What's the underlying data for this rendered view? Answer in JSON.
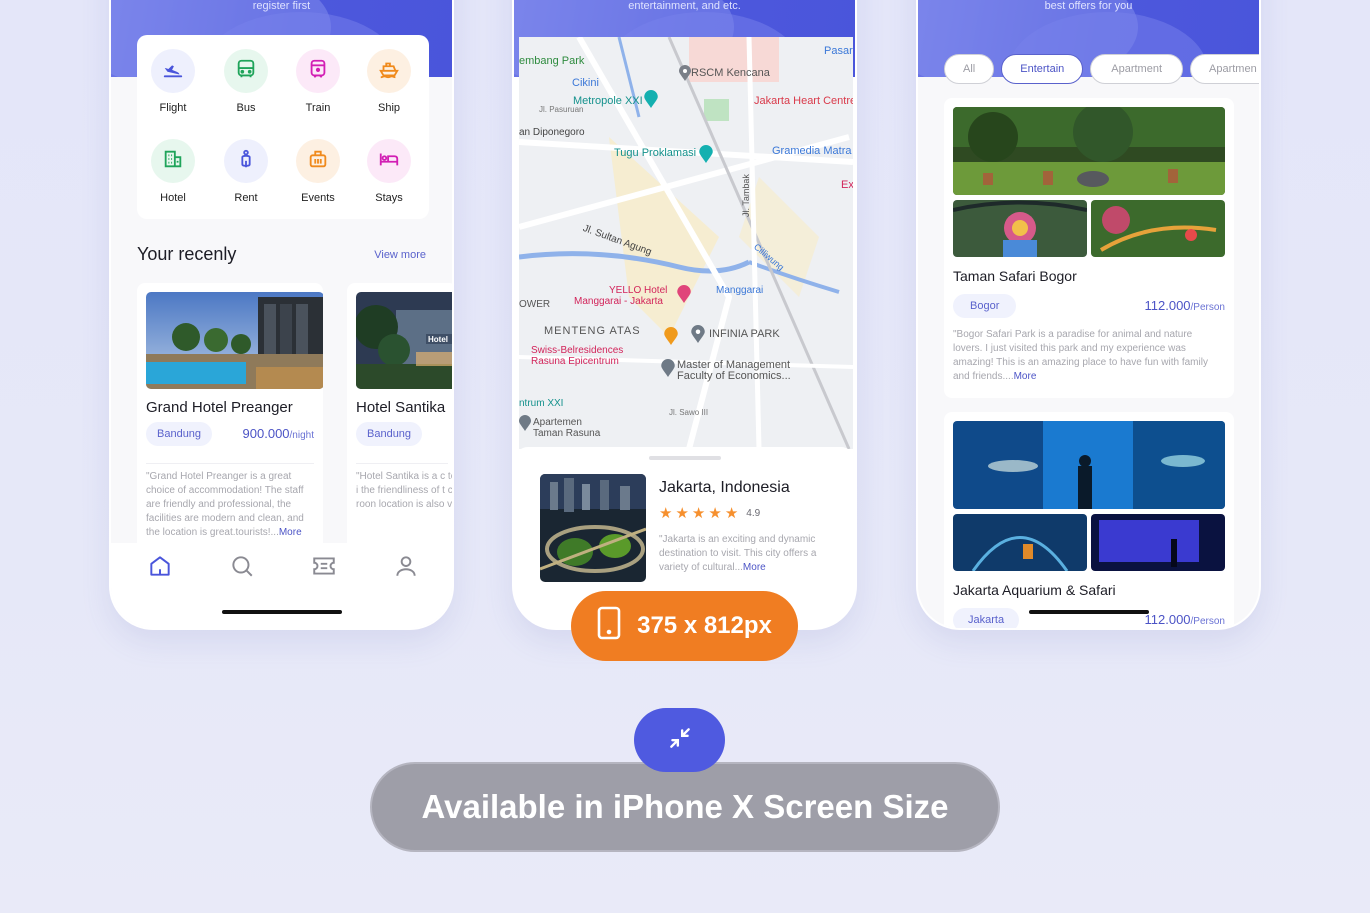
{
  "phone_home": {
    "header_text": "register first",
    "categories": [
      {
        "label": "Flight",
        "icon": "flight-icon",
        "color": "#4a55db",
        "bg": "#eef0fd"
      },
      {
        "label": "Bus",
        "icon": "bus-icon",
        "color": "#1fa45a",
        "bg": "#e7f7ee"
      },
      {
        "label": "Train",
        "icon": "train-icon",
        "color": "#d21fb4",
        "bg": "#fce9f8"
      },
      {
        "label": "Ship",
        "icon": "ship-icon",
        "color": "#f08a1c",
        "bg": "#fdf0e2"
      },
      {
        "label": "Hotel",
        "icon": "hotel-icon",
        "color": "#1fa45a",
        "bg": "#e7f7ee"
      },
      {
        "label": "Rent",
        "icon": "scooter-icon",
        "color": "#4a55db",
        "bg": "#eef0fd"
      },
      {
        "label": "Events",
        "icon": "suitcase-icon",
        "color": "#f08a1c",
        "bg": "#fdf0e2"
      },
      {
        "label": "Stays",
        "icon": "bed-icon",
        "color": "#d21fb4",
        "bg": "#fce9f8"
      }
    ],
    "section_title": "Your recenly",
    "view_more": "View more",
    "hotels": [
      {
        "name": "Grand Hotel Preanger",
        "city": "Bandung",
        "price": "900.000",
        "price_unit": "/night",
        "description": "\"Grand Hotel Preanger is a great choice of accommodation! The staff are friendly and professional, the facilities are modern and clean, and the location is great.tourists!...",
        "more": "More"
      },
      {
        "name": "Hotel Santika",
        "city": "Bandung",
        "description": "\"Hotel Santika is a c to stay! I was very i the friendliness of t comfort of the roon location is also very"
      }
    ],
    "nav": [
      "home-icon",
      "search-icon",
      "ticket-icon",
      "profile-icon"
    ]
  },
  "phone_map": {
    "header_text": "entertainment, and etc.",
    "map_labels": [
      {
        "text": "Pasar",
        "color": "#3b78d8"
      },
      {
        "text": "embang Park",
        "color": "#2e8b3e"
      },
      {
        "text": "RSCM Kencana",
        "color": "#555"
      },
      {
        "text": "Cikini",
        "color": "#3b78d8"
      },
      {
        "text": "Metropole XXI",
        "color": "#14918c"
      },
      {
        "text": "Jl. Pasuruan",
        "color": "#777"
      },
      {
        "text": "Jakarta Heart Centre",
        "color": "#d93a4a"
      },
      {
        "text": "an Diponegoro",
        "color": "#444"
      },
      {
        "text": "Tugu Proklamasi",
        "color": "#14918c"
      },
      {
        "text": "Gramedia Matra",
        "color": "#3b78d8"
      },
      {
        "text": "Ex",
        "color": "#d2245a"
      },
      {
        "text": "Jl. Tambak",
        "color": "#555"
      },
      {
        "text": "Jl. Sultan Agung",
        "color": "#444"
      },
      {
        "text": "Cilliwung",
        "color": "#3b78d8"
      },
      {
        "text": "YELLO Hotel",
        "color": "#d2245a"
      },
      {
        "text": "Manggarai - Jakarta",
        "color": "#d2245a"
      },
      {
        "text": "Manggarai",
        "color": "#3b78d8"
      },
      {
        "text": "OWER",
        "color": "#555"
      },
      {
        "text": "MENTENG ATAS",
        "color": "#555"
      },
      {
        "text": "INFINIA PARK",
        "color": "#555"
      },
      {
        "text": "Swiss-Belresidences",
        "color": "#d2245a"
      },
      {
        "text": "Rasuna Epicentrum",
        "color": "#d2245a"
      },
      {
        "text": "Master of Management",
        "color": "#555"
      },
      {
        "text": "Faculty of Economics...",
        "color": "#555"
      },
      {
        "text": "ntrum XXI",
        "color": "#14918c"
      },
      {
        "text": "Apartemen",
        "color": "#555"
      },
      {
        "text": "Taman Rasuna",
        "color": "#555"
      },
      {
        "text": "Jl. Sawo III",
        "color": "#777"
      }
    ],
    "place": {
      "name": "Jakarta, Indonesia",
      "stars": 5,
      "rating": "4.9",
      "description": "\"Jakarta is an exciting and dynamic destination to visit. This city offers a variety of cultural...",
      "more": "More"
    }
  },
  "phone_offers": {
    "header_text": "best offers for you",
    "tabs": [
      {
        "label": "All",
        "active": false
      },
      {
        "label": "Entertain",
        "active": true
      },
      {
        "label": "Apartment",
        "active": false
      },
      {
        "label": "Apartmen",
        "active": false
      }
    ],
    "offers": [
      {
        "name": "Taman Safari Bogor",
        "city": "Bogor",
        "price": "112.000",
        "price_unit": "/Person",
        "description": "\"Bogor Safari Park is a paradise for animal and nature lovers. I just visited this park and my experience was amazing! This is an amazing place to have fun with family and friends....",
        "more": "More"
      },
      {
        "name": "Jakarta Aquarium & Safari",
        "city": "Jakarta",
        "price": "112.000",
        "price_unit": "/Person"
      }
    ]
  },
  "badges": {
    "size_label": "375 x 812px",
    "size_icon": "phone-icon",
    "compress_icon": "compress-icon",
    "available_label": "Available in iPhone X Screen Size",
    "accent_orange": "#f07d22",
    "accent_blue": "#4f5ae0"
  }
}
